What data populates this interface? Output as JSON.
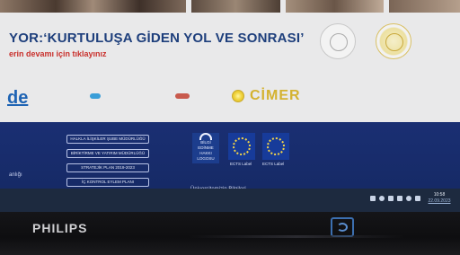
{
  "banner": {
    "title": "YOR:‘KURTULUŞA GİDEN YOL VE SONRASI’",
    "subtitle": "erin devamı için tıklayınız"
  },
  "logos": {
    "de": "de",
    "cimer": "CİMER"
  },
  "footer": {
    "buttons": [
      "HALKLA İLİŞKİLER ŞUBE MÜDÜRLÜĞÜ",
      "BİRİKTİRME VE YATIRIM MÜDÜRLÜĞÜ",
      "STRATEJİK PLAN 2019-2023",
      "İÇ KONTROL EYLEM PLANI"
    ],
    "badge_text": "BİLGİ EDİNME HAKKI LOGOSU",
    "eu_caption_1": "ECTS Label",
    "eu_caption_2": "ECTS Label",
    "left_text": "anlığı",
    "bottom_link": "Üniversitemizin Bilgileri"
  },
  "taskbar": {
    "clock_time": "10:58",
    "clock_date": "22.09.2023"
  },
  "bezel": {
    "brand": "PHILIPS"
  },
  "colors": {
    "title_blue": "#1e3f7c",
    "subtitle_red": "#c9302c",
    "footer_blue": "#1a2f73",
    "cimer_gold": "#d4b230"
  }
}
